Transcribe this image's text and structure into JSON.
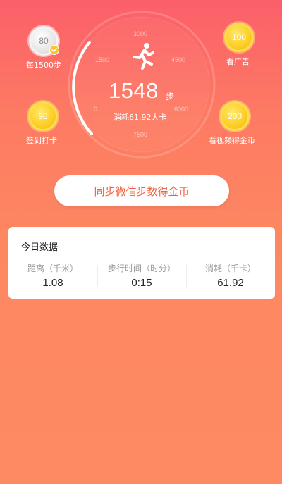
{
  "gauge": {
    "ticks": [
      "3000",
      "1500",
      "4500",
      "0",
      "6000",
      "7500"
    ],
    "steps": "1548",
    "steps_unit": "步",
    "calorie_text": "消耗61.92大卡"
  },
  "coins": {
    "every_steps": {
      "value": "80",
      "caption": "每1500步"
    },
    "watch_ad": {
      "value": "100",
      "caption": "看广告"
    },
    "checkin": {
      "value": "98",
      "caption": "签到打卡"
    },
    "watch_video": {
      "value": "200",
      "caption": "看视频得金币"
    }
  },
  "sync_button": {
    "label": "同步微信步数得金币"
  },
  "today": {
    "title": "今日数据",
    "stats": [
      {
        "label": "距离（千米）",
        "value": "1.08"
      },
      {
        "label": "步行时间（时分）",
        "value": "0:15"
      },
      {
        "label": "消耗（千卡）",
        "value": "61.92"
      }
    ]
  },
  "colors": {
    "accent": "#f0603d",
    "coin_gold": "#fdd02a"
  },
  "icons": [
    "running-person-icon",
    "checkmark-icon"
  ]
}
